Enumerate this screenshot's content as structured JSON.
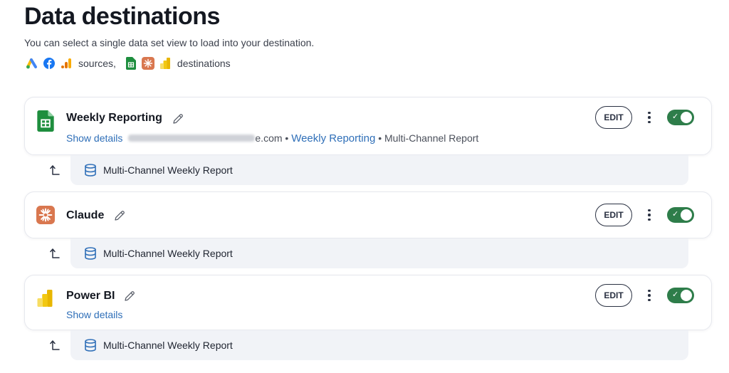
{
  "page": {
    "title": "Data destinations",
    "subtitle": "You can select a single data set view to load into your destination.",
    "sources_label": "sources,",
    "destinations_label": "destinations"
  },
  "legend": {
    "source_icons": [
      "google-ads-icon",
      "facebook-icon",
      "google-analytics-icon"
    ],
    "destination_icons": [
      "google-sheets-icon",
      "claude-icon",
      "power-bi-icon"
    ]
  },
  "colors": {
    "accent_link": "#2f6fb8",
    "toggle_on": "#2e7d4a",
    "sheets_green": "#1e8e3e",
    "claude_orange": "#d9774f",
    "powerbi_yellow": "#f2c811"
  },
  "destinations": [
    {
      "name": "Weekly Reporting",
      "icon": "google-sheets-icon",
      "show_details": "Show details",
      "email_suffix": "e.com",
      "sep1": "•",
      "sheet_link": "Weekly Reporting",
      "sep2": "•",
      "report_name": "Multi-Channel Report",
      "edit_label": "EDIT",
      "enabled": true,
      "dataset": "Multi-Channel Weekly Report"
    },
    {
      "name": "Claude",
      "icon": "claude-icon",
      "edit_label": "EDIT",
      "enabled": true,
      "dataset": "Multi-Channel Weekly Report"
    },
    {
      "name": "Power BI",
      "icon": "power-bi-icon",
      "show_details": "Show details",
      "edit_label": "EDIT",
      "enabled": true,
      "dataset": "Multi-Channel Weekly Report"
    }
  ],
  "toggle_check": "✓"
}
